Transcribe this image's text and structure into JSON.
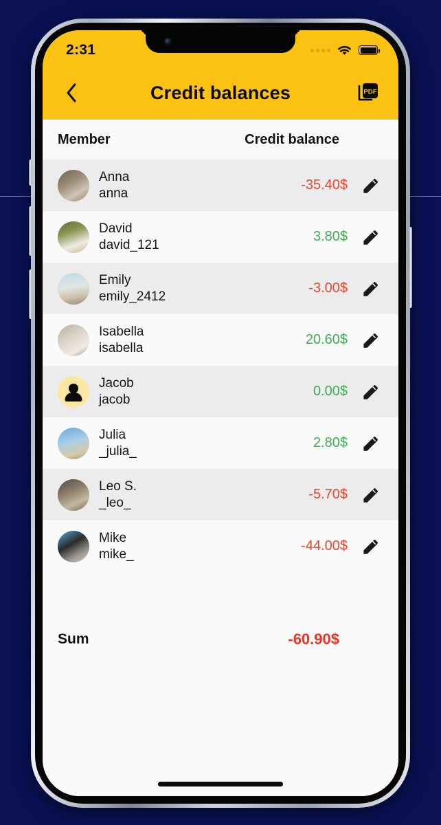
{
  "status_bar": {
    "clock": "2:31",
    "signal_icon": "signal-dots-icon",
    "wifi_icon": "wifi-icon",
    "battery_icon": "battery-full-icon"
  },
  "nav": {
    "back_icon": "chevron-left-icon",
    "title": "Credit balances",
    "pdf_icon": "pdf-export-icon",
    "pdf_label": "PDF"
  },
  "table": {
    "columns": {
      "member": "Member",
      "balance": "Credit balance"
    },
    "rows": [
      {
        "name": "Anna",
        "handle": "anna",
        "balance": "-35.40$",
        "sign": "neg",
        "avatar": "photo",
        "edit_icon": "pencil-icon"
      },
      {
        "name": "David",
        "handle": "david_121",
        "balance": "3.80$",
        "sign": "pos",
        "avatar": "photo",
        "edit_icon": "pencil-icon"
      },
      {
        "name": "Emily",
        "handle": "emily_2412",
        "balance": "-3.00$",
        "sign": "neg",
        "avatar": "photo",
        "edit_icon": "pencil-icon"
      },
      {
        "name": "Isabella",
        "handle": "isabella",
        "balance": "20.60$",
        "sign": "pos",
        "avatar": "photo",
        "edit_icon": "pencil-icon"
      },
      {
        "name": "Jacob",
        "handle": "jacob",
        "balance": "0.00$",
        "sign": "pos",
        "avatar": "placeholder",
        "edit_icon": "pencil-icon"
      },
      {
        "name": "Julia",
        "handle": "_julia_",
        "balance": "2.80$",
        "sign": "pos",
        "avatar": "photo",
        "edit_icon": "pencil-icon"
      },
      {
        "name": "Leo S.",
        "handle": "_leo_",
        "balance": "-5.70$",
        "sign": "neg",
        "avatar": "photo",
        "edit_icon": "pencil-icon"
      },
      {
        "name": "Mike",
        "handle": "mike_",
        "balance": "-44.00$",
        "sign": "neg",
        "avatar": "photo",
        "edit_icon": "pencil-icon"
      }
    ],
    "summary": {
      "label": "Sum",
      "value": "-60.90$"
    }
  },
  "colors": {
    "brand_yellow": "#FBC213",
    "negative": "#F0432B",
    "positive": "#3BAE52",
    "sum_negative": "#F03020",
    "row_alt": "#ECECEC",
    "row_plain": "#FAFAFA",
    "backdrop": "#0a1154"
  }
}
